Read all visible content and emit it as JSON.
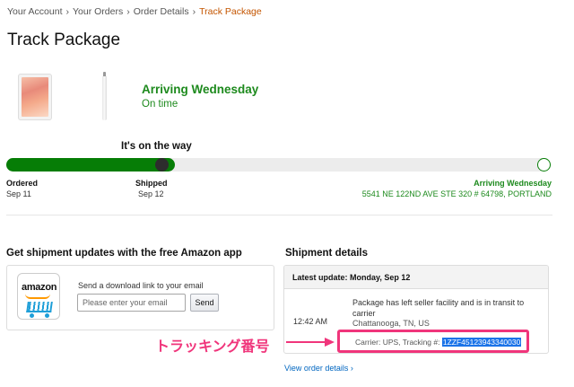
{
  "breadcrumb": [
    {
      "label": "Your Account"
    },
    {
      "label": "Your Orders"
    },
    {
      "label": "Order Details"
    },
    {
      "label": "Track Package"
    }
  ],
  "breadcrumb_sep": "›",
  "page_title": "Track Package",
  "arrival": {
    "title": "Arriving Wednesday",
    "status": "On time"
  },
  "progress": {
    "heading": "It's on the way",
    "fraction_complete": 0.31,
    "stages": [
      {
        "label": "Ordered",
        "date": "Sep 11"
      },
      {
        "label": "Shipped",
        "date": "Sep 12"
      }
    ],
    "destination_label": "Arriving Wednesday",
    "destination_address": "5541 NE 122ND AVE STE 320 # 64798, PORTLAND"
  },
  "app_section": {
    "heading": "Get shipment updates with the free Amazon app",
    "logo_text": "amazon",
    "prompt": "Send a download link to your email",
    "email_placeholder": "Please enter your email",
    "send_label": "Send"
  },
  "shipment": {
    "heading": "Shipment details",
    "latest_update": "Latest update: Monday, Sep 12",
    "event_time": "12:42 AM",
    "event_description": "Package has left seller facility and is in transit to carrier",
    "event_location": "Chattanooga, TN, US",
    "carrier_text": "Carrier: UPS, Tracking #: ",
    "tracking_number": "1ZZF45123943340030",
    "view_link": "View order details ›"
  },
  "annotation": {
    "label": "トラッキング番号"
  },
  "colors": {
    "green": "#067d06",
    "highlight_pink": "#f0357b",
    "link_blue": "#0066c0",
    "breadcrumb_active": "#c45500"
  }
}
